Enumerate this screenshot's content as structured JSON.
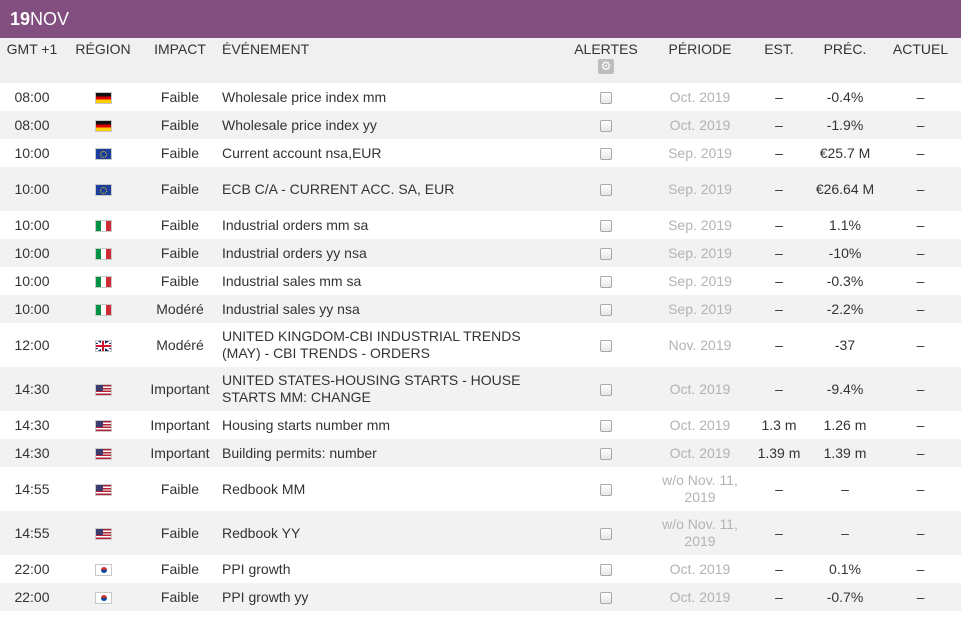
{
  "header": {
    "day": "19",
    "month": "NOV"
  },
  "columns": {
    "time": "GMT +1",
    "region": "RÉGION",
    "impact": "IMPACT",
    "event": "ÉVÉNEMENT",
    "alerts": "ALERTES",
    "period": "PÉRIODE",
    "est": "EST.",
    "prev": "PRÉC.",
    "actual": "ACTUEL"
  },
  "alerts_settings_icon": "gear-icon",
  "rows": [
    {
      "time": "08:00",
      "region": "de",
      "impact": "Faible",
      "event": "Wholesale price index mm",
      "period": "Oct. 2019",
      "est": "–",
      "prev": "-0.4%",
      "actual": "–"
    },
    {
      "time": "08:00",
      "region": "de",
      "impact": "Faible",
      "event": "Wholesale price index yy",
      "period": "Oct. 2019",
      "est": "–",
      "prev": "-1.9%",
      "actual": "–"
    },
    {
      "time": "10:00",
      "region": "eu",
      "impact": "Faible",
      "event": "Current account nsa,EUR",
      "period": "Sep. 2019",
      "est": "–",
      "prev": "€25.7 M",
      "actual": "–"
    },
    {
      "time": "10:00",
      "region": "eu",
      "impact": "Faible",
      "event": "ECB C/A - CURRENT ACC. SA, EUR",
      "period": "Sep. 2019",
      "est": "–",
      "prev": "€26.64 M",
      "actual": "–"
    },
    {
      "time": "10:00",
      "region": "it",
      "impact": "Faible",
      "event": "Industrial orders mm sa",
      "period": "Sep. 2019",
      "est": "–",
      "prev": "1.1%",
      "actual": "–"
    },
    {
      "time": "10:00",
      "region": "it",
      "impact": "Faible",
      "event": "Industrial orders yy nsa",
      "period": "Sep. 2019",
      "est": "–",
      "prev": "-10%",
      "actual": "–"
    },
    {
      "time": "10:00",
      "region": "it",
      "impact": "Faible",
      "event": "Industrial sales mm sa",
      "period": "Sep. 2019",
      "est": "–",
      "prev": "-0.3%",
      "actual": "–"
    },
    {
      "time": "10:00",
      "region": "it",
      "impact": "Modéré",
      "event": "Industrial sales yy nsa",
      "period": "Sep. 2019",
      "est": "–",
      "prev": "-2.2%",
      "actual": "–"
    },
    {
      "time": "12:00",
      "region": "gb",
      "impact": "Modéré",
      "event": "UNITED KINGDOM-CBI INDUSTRIAL TRENDS (MAY) - CBI TRENDS - ORDERS",
      "period": "Nov. 2019",
      "est": "–",
      "prev": "-37",
      "actual": "–"
    },
    {
      "time": "14:30",
      "region": "us",
      "impact": "Important",
      "event": "UNITED STATES-HOUSING STARTS - HOUSE STARTS MM: CHANGE",
      "period": "Oct. 2019",
      "est": "–",
      "prev": "-9.4%",
      "actual": "–"
    },
    {
      "time": "14:30",
      "region": "us",
      "impact": "Important",
      "event": "Housing starts number mm",
      "period": "Oct. 2019",
      "est": "1.3 m",
      "prev": "1.26 m",
      "actual": "–"
    },
    {
      "time": "14:30",
      "region": "us",
      "impact": "Important",
      "event": "Building permits: number",
      "period": "Oct. 2019",
      "est": "1.39 m",
      "prev": "1.39 m",
      "actual": "–"
    },
    {
      "time": "14:55",
      "region": "us",
      "impact": "Faible",
      "event": "Redbook MM",
      "period": "w/o Nov. 11, 2019",
      "est": "–",
      "prev": "–",
      "actual": "–"
    },
    {
      "time": "14:55",
      "region": "us",
      "impact": "Faible",
      "event": "Redbook YY",
      "period": "w/o Nov. 11, 2019",
      "est": "–",
      "prev": "–",
      "actual": "–"
    },
    {
      "time": "22:00",
      "region": "kr",
      "impact": "Faible",
      "event": "PPI growth",
      "period": "Oct. 2019",
      "est": "–",
      "prev": "0.1%",
      "actual": "–"
    },
    {
      "time": "22:00",
      "region": "kr",
      "impact": "Faible",
      "event": "PPI growth yy",
      "period": "Oct. 2019",
      "est": "–",
      "prev": "-0.7%",
      "actual": "–"
    }
  ],
  "colors": {
    "header_bg": "#834f80",
    "header_text": "#ffffff",
    "column_header_bg": "#f0f0f0",
    "stripe_bg": "#f2f2f2",
    "period_text": "#b3b3b3"
  }
}
